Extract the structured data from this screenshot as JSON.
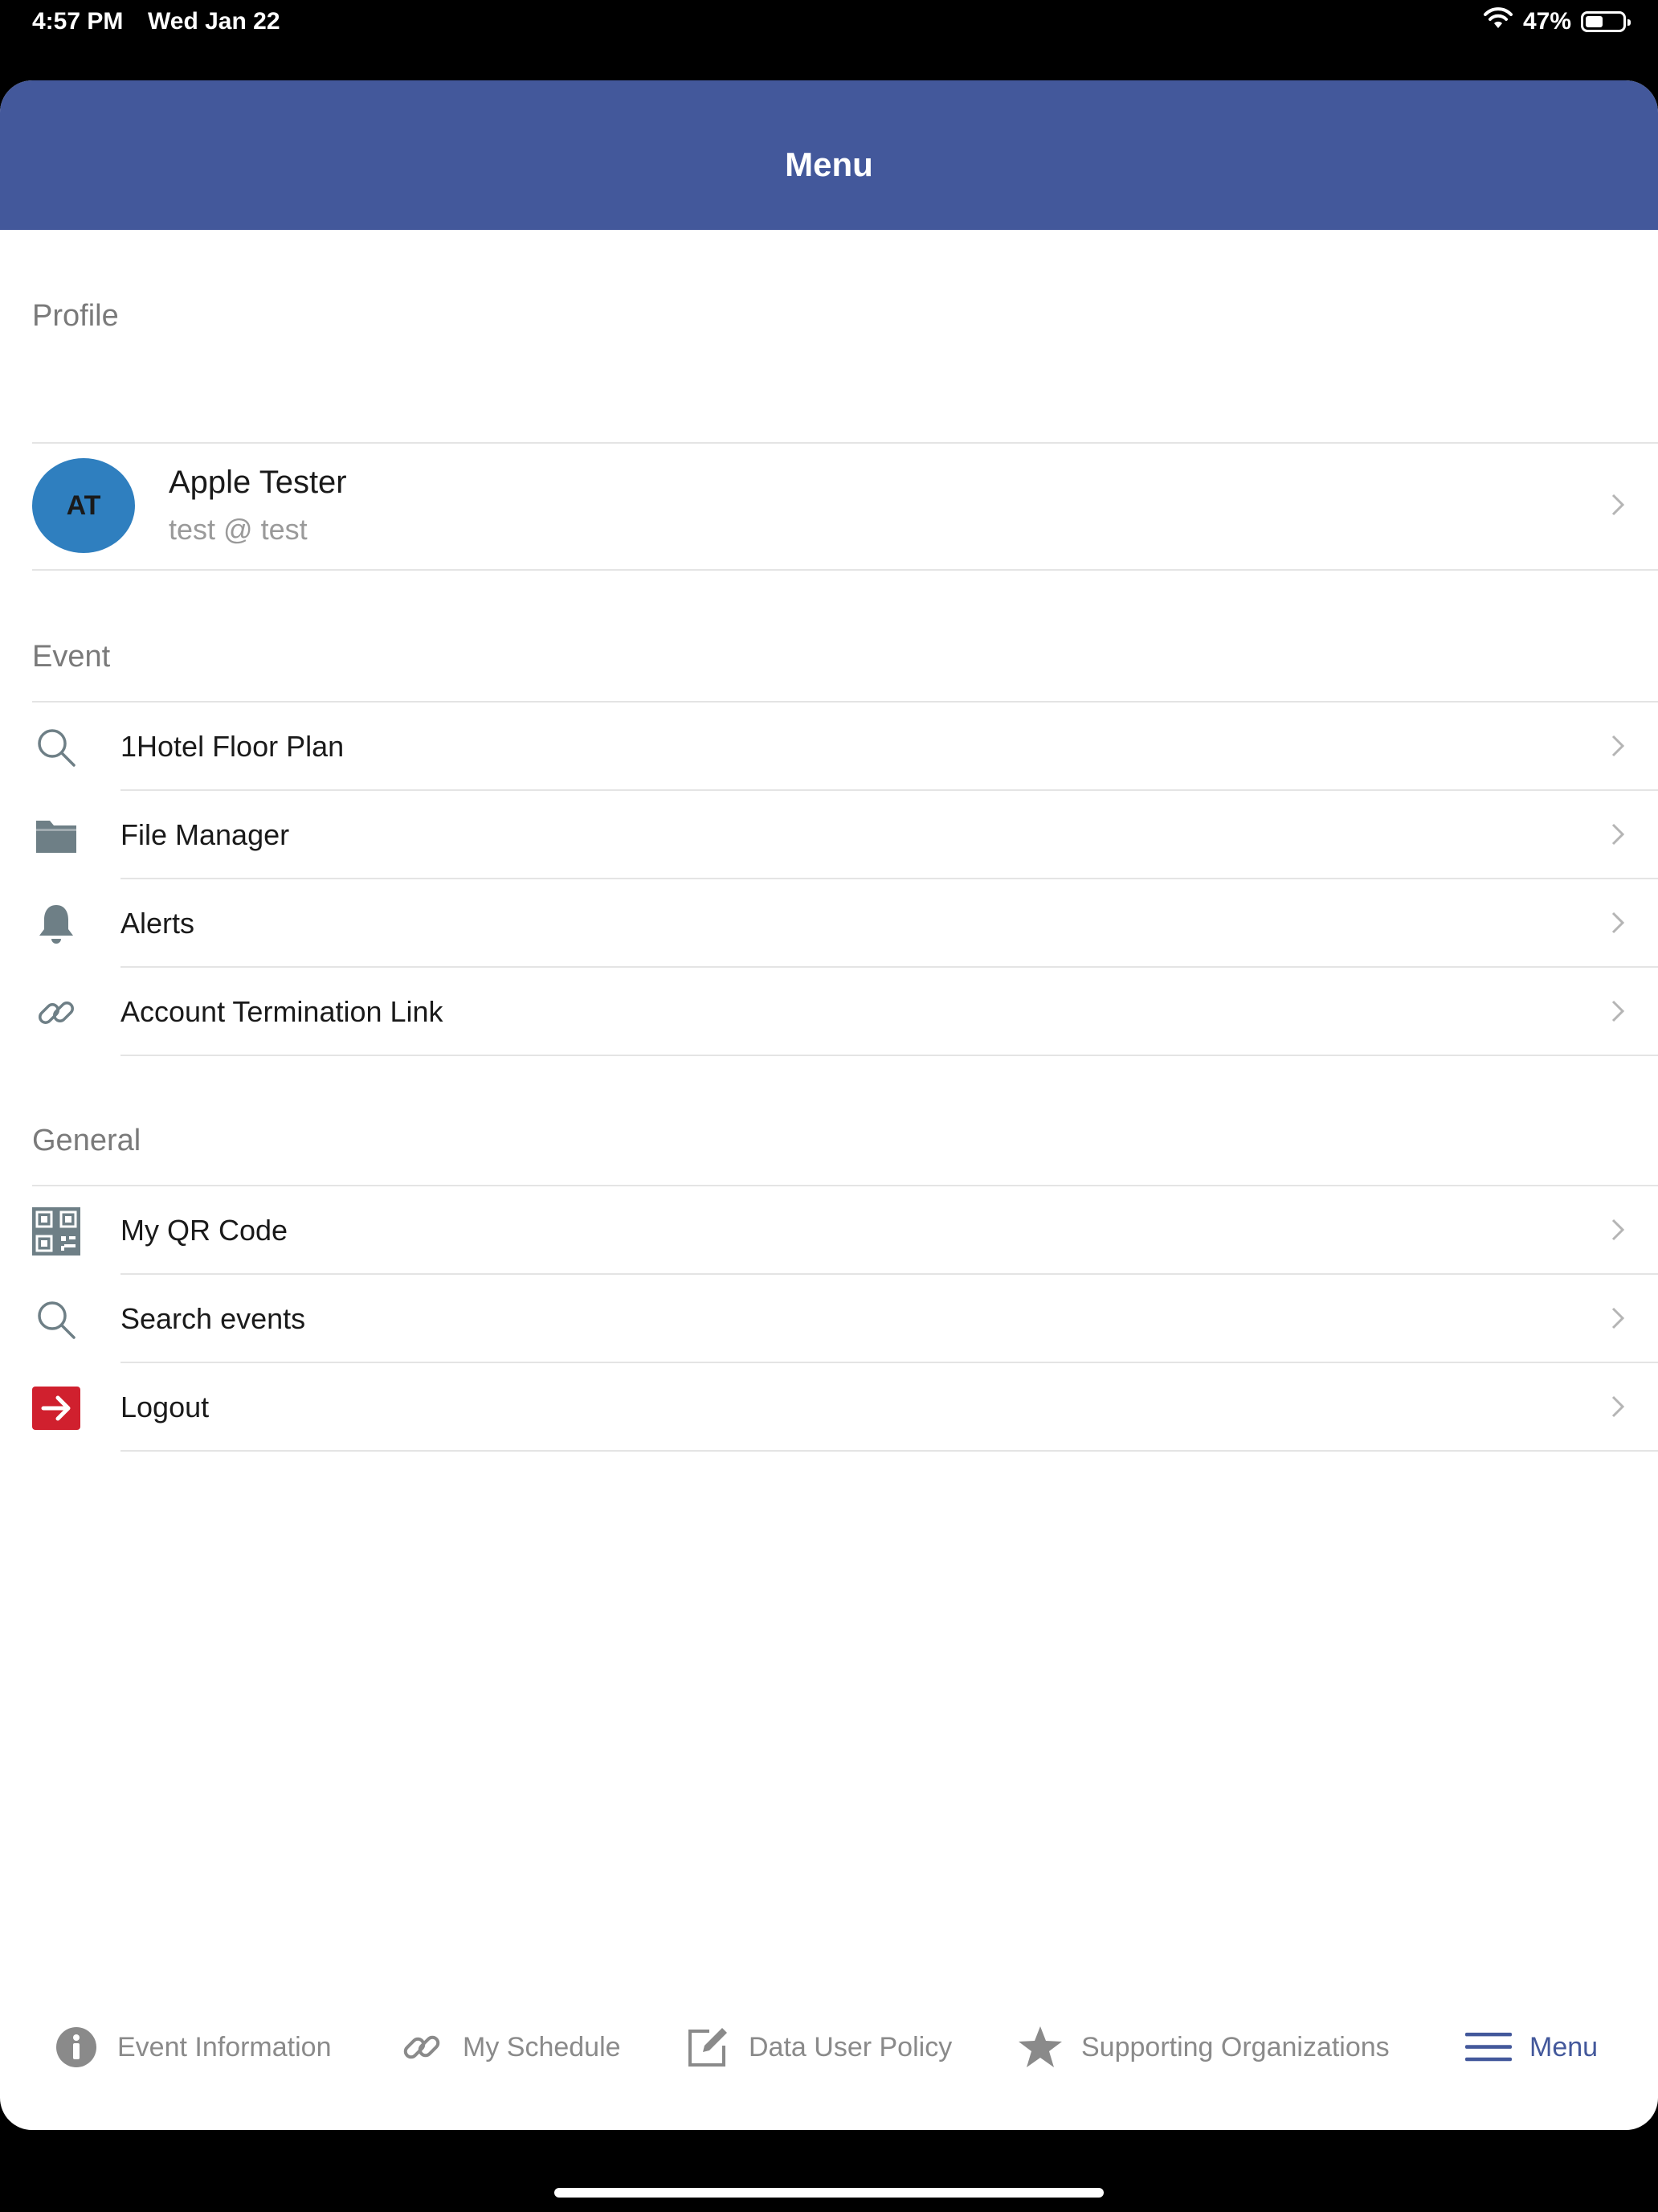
{
  "status_bar": {
    "time": "4:57 PM",
    "date": "Wed Jan 22",
    "battery": "47%",
    "battery_level": 0.47
  },
  "nav": {
    "title": "Menu"
  },
  "profile": {
    "header": "Profile",
    "initials": "AT",
    "name": "Apple Tester",
    "subtitle": "test @ test",
    "avatar_color": "#2f7fbf"
  },
  "event": {
    "header": "Event",
    "items": [
      {
        "label": "1Hotel Floor Plan",
        "icon": "search-icon"
      },
      {
        "label": "File Manager",
        "icon": "folder-icon"
      },
      {
        "label": "Alerts",
        "icon": "bell-icon"
      },
      {
        "label": "Account Termination Link",
        "icon": "link-icon"
      }
    ]
  },
  "general": {
    "header": "General",
    "items": [
      {
        "label": "My QR Code",
        "icon": "qr-code-icon"
      },
      {
        "label": "Search events",
        "icon": "search-icon"
      },
      {
        "label": "Logout",
        "icon": "logout-icon"
      }
    ]
  },
  "tabs": [
    {
      "label": "Event Information",
      "icon": "info-icon"
    },
    {
      "label": "My Schedule",
      "icon": "link-icon"
    },
    {
      "label": "Data User Policy",
      "icon": "edit-icon"
    },
    {
      "label": "Supporting Organizations",
      "icon": "star-icon"
    },
    {
      "label": "Menu",
      "icon": "hamburger-icon",
      "active": true
    }
  ],
  "colors": {
    "nav_bar": "#43589b",
    "active_tab": "#43589b",
    "icon_gray": "#6e7f86",
    "logout_red": "#d0202e"
  }
}
